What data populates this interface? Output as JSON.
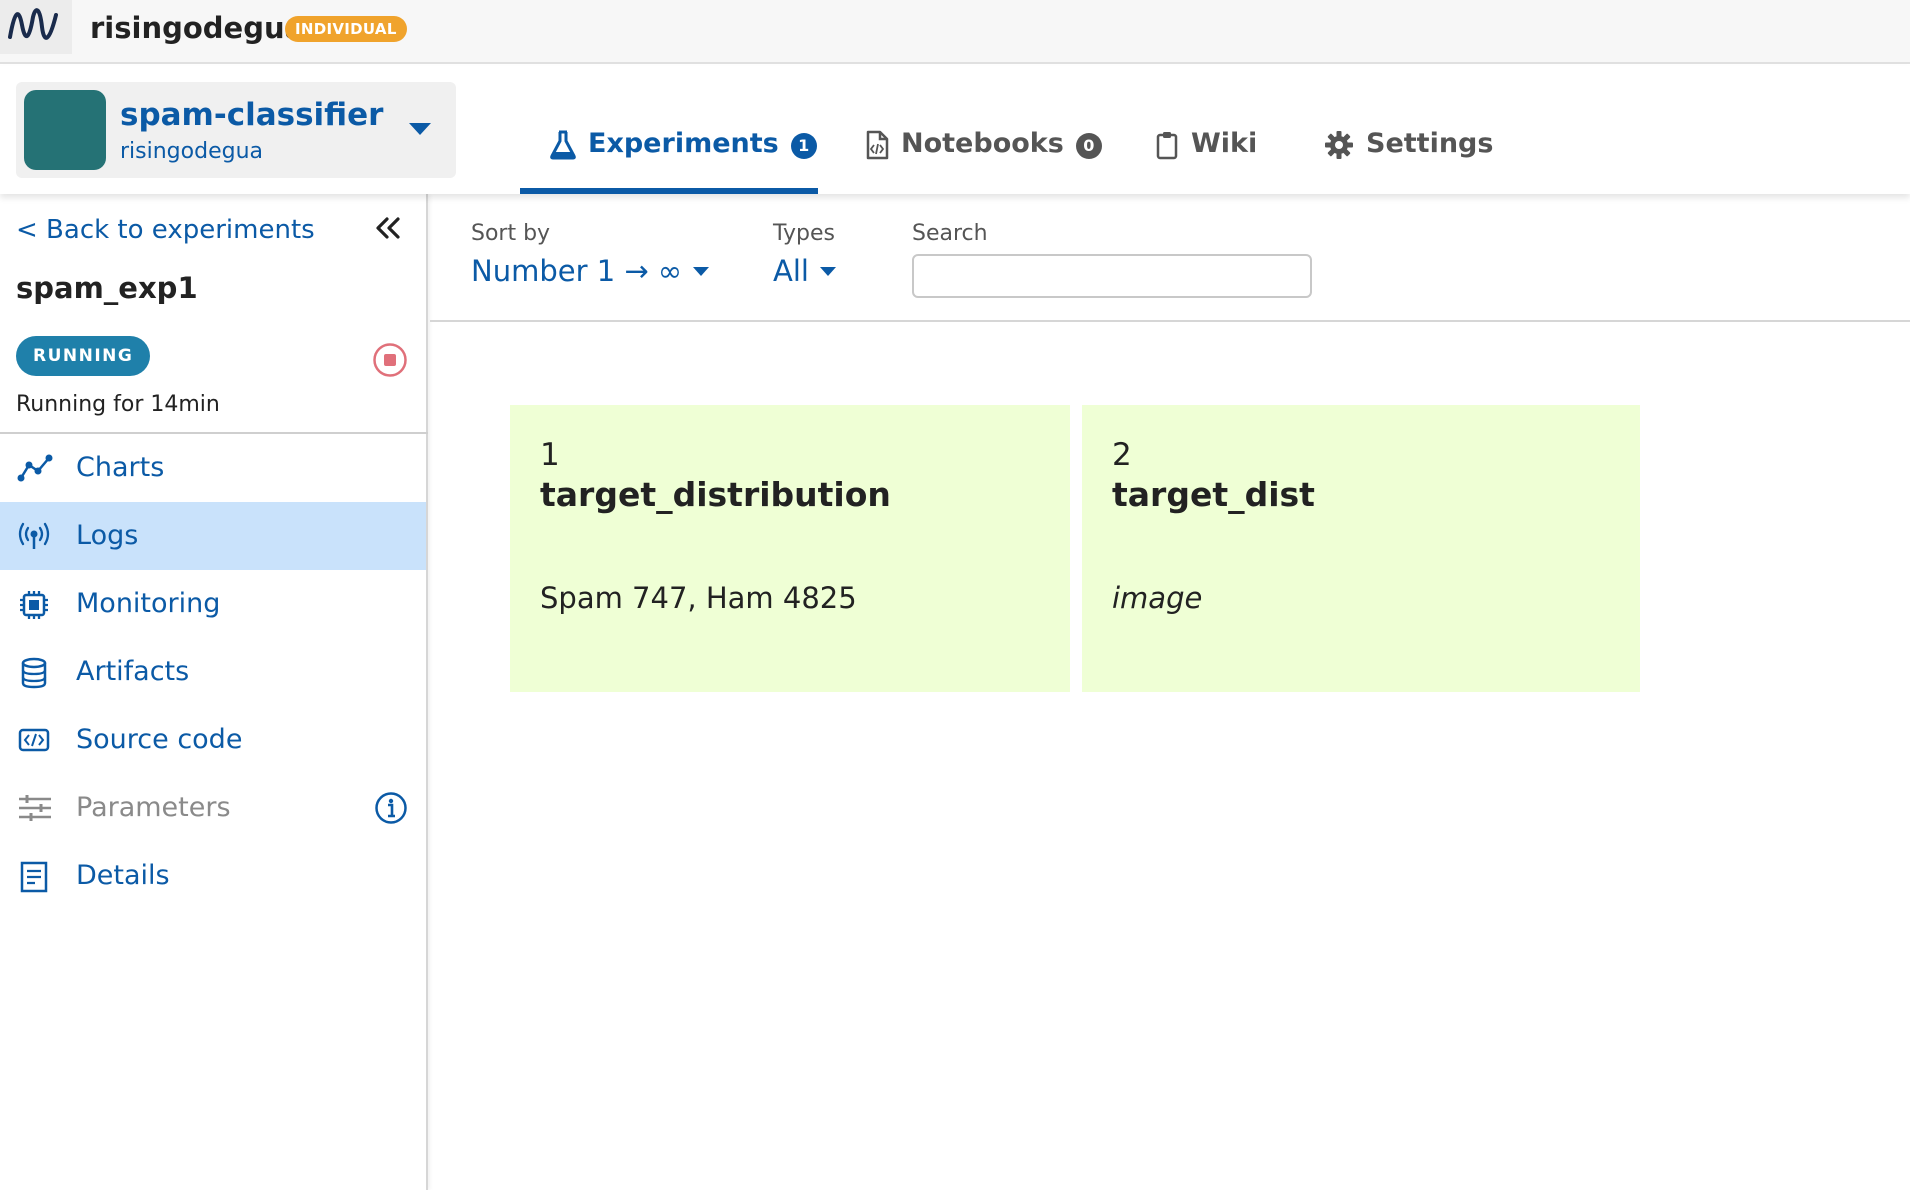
{
  "topbar": {
    "workspace": "risingodegua",
    "plan_badge": "INDIVIDUAL"
  },
  "project": {
    "name": "spam-classifier",
    "owner": "risingodegua",
    "avatar_color": "#257275"
  },
  "tabs": [
    {
      "label": "Experiments",
      "count": "1",
      "icon": "flask-icon",
      "active": true
    },
    {
      "label": "Notebooks",
      "count": "0",
      "icon": "notebook-file-icon",
      "active": false
    },
    {
      "label": "Wiki",
      "icon": "clipboard-icon",
      "active": false
    },
    {
      "label": "Settings",
      "icon": "gear-icon",
      "active": false
    }
  ],
  "sidebar": {
    "back_label": "< Back to experiments",
    "experiment_name": "spam_exp1",
    "status": "RUNNING",
    "status_color": "#1f80aa",
    "running_for": "Running for 14min",
    "items": [
      {
        "label": "Charts",
        "icon": "line-chart-icon",
        "active": false,
        "disabled": false
      },
      {
        "label": "Logs",
        "icon": "broadcast-icon",
        "active": true,
        "disabled": false
      },
      {
        "label": "Monitoring",
        "icon": "cpu-chip-icon",
        "active": false,
        "disabled": false
      },
      {
        "label": "Artifacts",
        "icon": "database-icon",
        "active": false,
        "disabled": false
      },
      {
        "label": "Source code",
        "icon": "code-icon",
        "active": false,
        "disabled": false
      },
      {
        "label": "Parameters",
        "icon": "sliders-icon",
        "active": false,
        "disabled": true
      },
      {
        "label": "Details",
        "icon": "document-list-icon",
        "active": false,
        "disabled": false
      }
    ]
  },
  "filters": {
    "sort_label": "Sort by",
    "sort_value": "Number 1 → ∞",
    "types_label": "Types",
    "types_value": "All",
    "search_label": "Search",
    "search_value": "",
    "search_placeholder": ""
  },
  "logs": [
    {
      "number": "1",
      "name": "target_distribution",
      "value": "Spam 747, Ham 4825",
      "italic": false
    },
    {
      "number": "2",
      "name": "target_dist",
      "value": "image",
      "italic": true
    }
  ],
  "colors": {
    "accent": "#0b5aa6",
    "card_bg": "#efffd5",
    "active_nav_bg": "#c9e2fb",
    "badge_orange": "#f0a32c",
    "stop_red": "#e0707a"
  }
}
